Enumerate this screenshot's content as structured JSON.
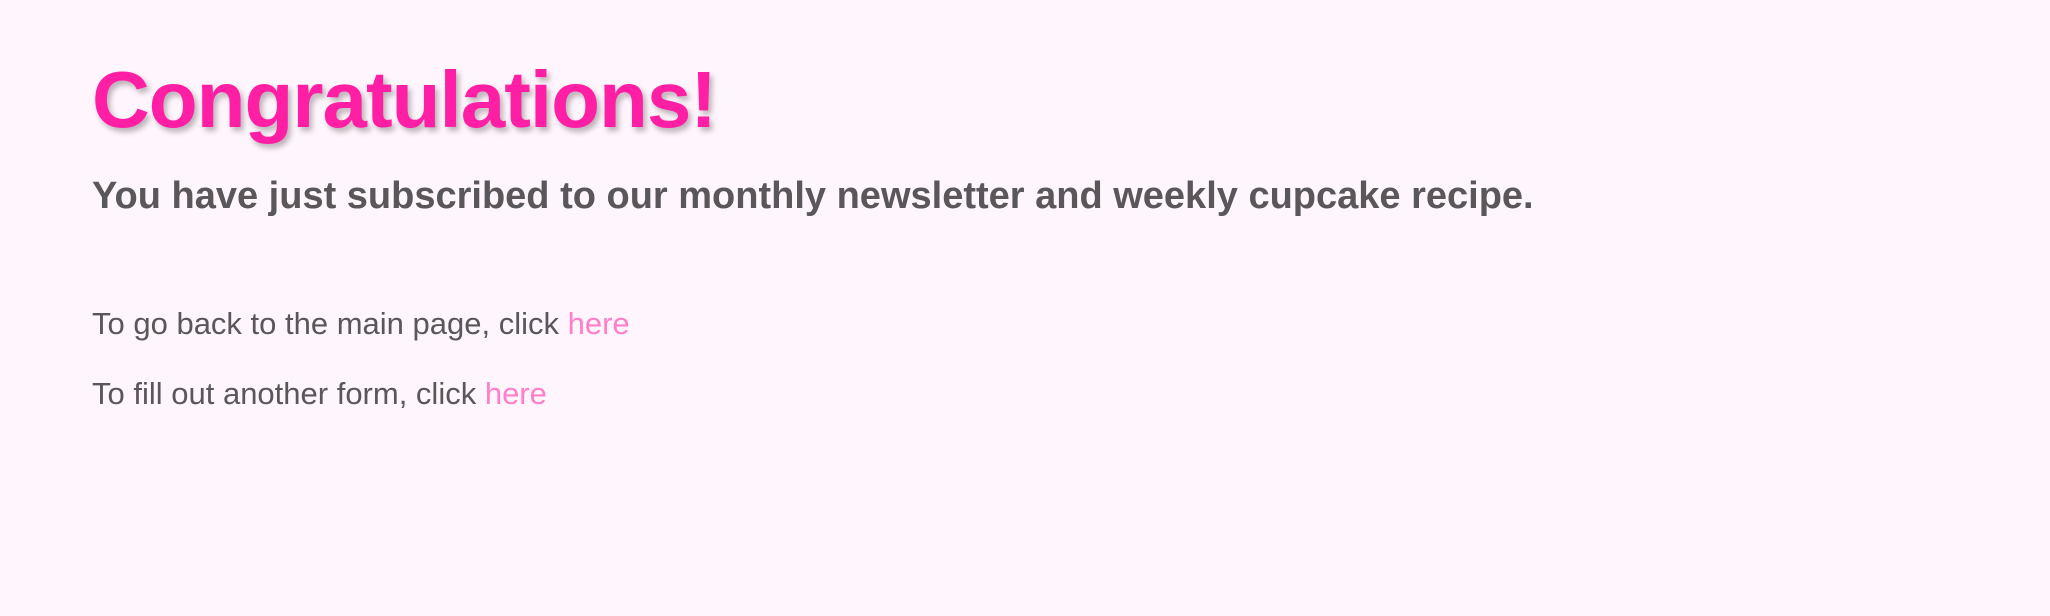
{
  "heading": "Congratulations!",
  "subheading": "You have just subscribed to our monthly newsletter and weekly cupcake recipe.",
  "links": [
    {
      "prefix": "To go back to the main page, click ",
      "link_text": "here"
    },
    {
      "prefix": "To fill out another form, click ",
      "link_text": "here"
    }
  ],
  "colors": {
    "background": "#fff5fc",
    "heading": "#ff1fa5",
    "text": "#5a5659",
    "link": "#ff7fcb"
  }
}
